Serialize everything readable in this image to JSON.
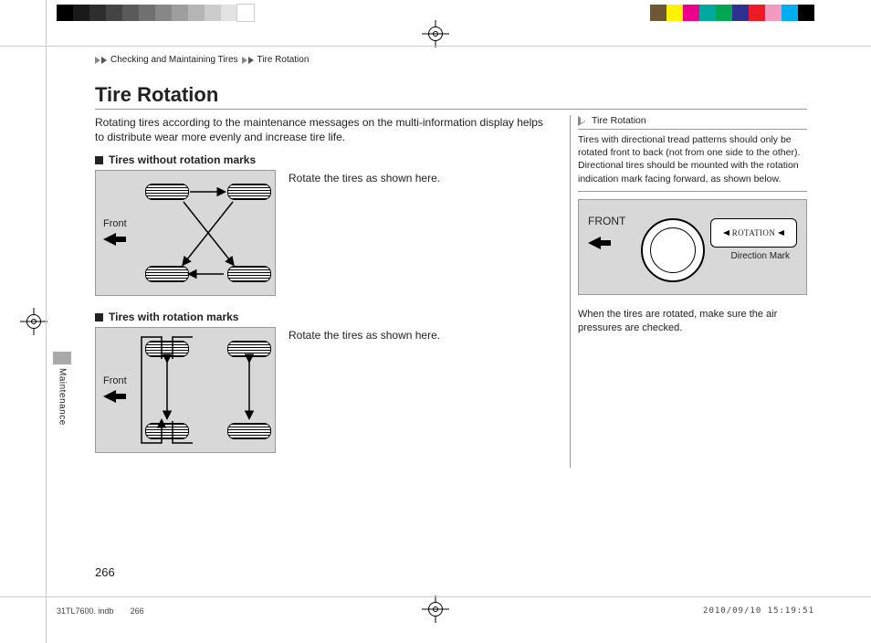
{
  "prepress": {
    "gray_swatches": [
      "#000000",
      "#1a1a1a",
      "#2e2e2e",
      "#444444",
      "#5a5a5a",
      "#707070",
      "#878787",
      "#9e9e9e",
      "#b5b5b5",
      "#cccccc",
      "#e3e3e3",
      "#ffffff"
    ],
    "color_swatches": [
      "#6e5735",
      "#fff200",
      "#ec008c",
      "#00a99d",
      "#00a651",
      "#2e3192",
      "#ed1c24",
      "#f49ac1",
      "#00aeef",
      "#000000"
    ]
  },
  "breadcrumb": {
    "a": "Checking and Maintaining Tires",
    "b": "Tire Rotation"
  },
  "title": "Tire Rotation",
  "intro": "Rotating tires according to the maintenance messages on the multi-information display helps to distribute wear more evenly and increase tire life.",
  "sections": {
    "without_marks": {
      "heading": "Tires without rotation marks",
      "caption": "Rotate the tires as shown here.",
      "front_label": "Front"
    },
    "with_marks": {
      "heading": "Tires with rotation marks",
      "caption": "Rotate the tires as shown here.",
      "front_label": "Front"
    }
  },
  "sidebar": {
    "title": "Tire Rotation",
    "body": "Tires with directional tread patterns should only be rotated front to back (not from one side to the other).\nDirectional tires should be mounted with the rotation indication mark facing forward, as shown below.",
    "diagram": {
      "front": "FRONT",
      "rotation": "ROTATION",
      "direction_mark": "Direction Mark"
    },
    "footer": "When the tires are rotated, make sure the air pressures are checked."
  },
  "side_tab": "Maintenance",
  "page_number": "266",
  "imprint": {
    "file": "31TL7600. indb",
    "page": "266",
    "timestamp": "2010/09/10   15:19:51"
  }
}
